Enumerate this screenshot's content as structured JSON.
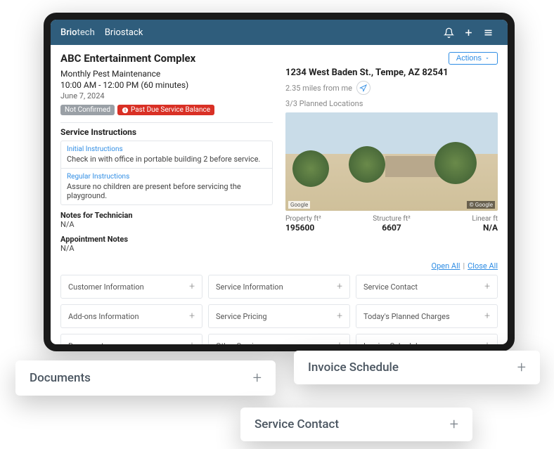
{
  "app": {
    "brand_pre": "Brio",
    "brand_sub": "tech",
    "product": "Briostack"
  },
  "actions": {
    "label": "Actions"
  },
  "customer": {
    "name": "ABC Entertainment Complex",
    "service": "Monthly Pest Maintenance",
    "time": "10:00 AM - 12:00 PM (60 minutes)",
    "date": "June 7, 2024",
    "badge_unconfirmed": "Not Confirmed",
    "badge_pastdue": "Past Due Service Balance"
  },
  "instructions": {
    "heading": "Service Instructions",
    "initial_label": "Initial Instructions",
    "initial_text": "Check in with office in portable building 2 before service.",
    "regular_label": "Regular Instructions",
    "regular_text": "Assure no children are present before servicing the playground."
  },
  "notes": {
    "tech_label": "Notes for Technician",
    "tech_val": "N/A",
    "appt_label": "Appointment Notes",
    "appt_val": "N/A"
  },
  "location": {
    "address": "1234 West Baden St., Tempe, AZ 82541",
    "distance": "2.35 miles from me",
    "planned": "3/3 Planned Locations",
    "google": "Google",
    "google2": "© Google"
  },
  "metrics": {
    "prop_label": "Property ft²",
    "prop_val": "195600",
    "struct_label": "Structure ft²",
    "struct_val": "6607",
    "linear_label": "Linear ft",
    "linear_val": "N/A"
  },
  "toggle": {
    "open": "Open All",
    "close": "Close All"
  },
  "panels": {
    "cust_info": "Customer Information",
    "svc_info": "Service Information",
    "svc_contact": "Service Contact",
    "addons": "Add-ons Information",
    "pricing": "Service Pricing",
    "charges": "Today's Planned Charges",
    "docs": "Documents",
    "other": "Other Services",
    "invoice": "Invoice Schedule"
  },
  "float": {
    "docs": "Documents",
    "invoice": "Invoice Schedule",
    "contact": "Service Contact"
  }
}
